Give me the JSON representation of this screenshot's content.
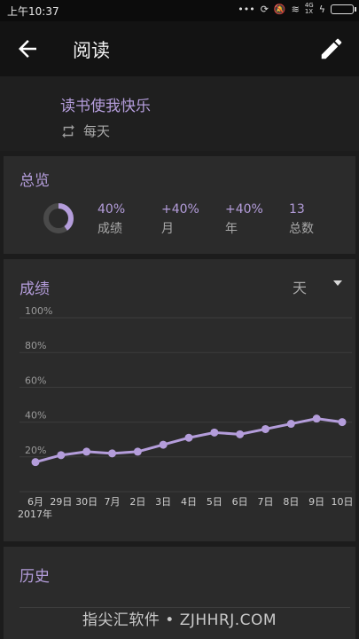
{
  "status_bar": {
    "time": "上午10:37",
    "network": "4G",
    "network_sub": "1X"
  },
  "app_bar": {
    "title": "阅读"
  },
  "habit": {
    "name": "读书使我快乐",
    "frequency": "每天"
  },
  "overview": {
    "title": "总览",
    "score_fraction": 0.4,
    "stats": [
      {
        "value": "40%",
        "label": "成绩"
      },
      {
        "value": "+40%",
        "label": "月"
      },
      {
        "value": "+40%",
        "label": "年"
      },
      {
        "value": "13",
        "label": "总数"
      }
    ]
  },
  "score_chart": {
    "title": "成绩",
    "period": "天",
    "year_label": "2017年"
  },
  "chart_data": {
    "type": "line",
    "title": "成绩",
    "xlabel": "",
    "ylabel": "",
    "categories": [
      "6月",
      "29日",
      "30日",
      "7月",
      "2日",
      "3日",
      "4日",
      "5日",
      "6日",
      "7日",
      "8日",
      "9日",
      "10日"
    ],
    "series": [
      {
        "values": [
          17,
          21,
          23,
          22,
          23,
          27,
          31,
          34,
          33,
          36,
          39,
          42,
          40
        ]
      }
    ],
    "y_ticks": [
      "100%",
      "80%",
      "60%",
      "40%",
      "20%"
    ],
    "ylim": [
      0,
      100
    ],
    "grid": true,
    "color": "#b49ddb"
  },
  "history": {
    "title": "历史"
  },
  "watermark": "指尖汇软件 • ZJHHRJ.COM",
  "colors": {
    "accent": "#b49ddb",
    "card": "#2b2b2b",
    "background": "#1c1c1c"
  }
}
